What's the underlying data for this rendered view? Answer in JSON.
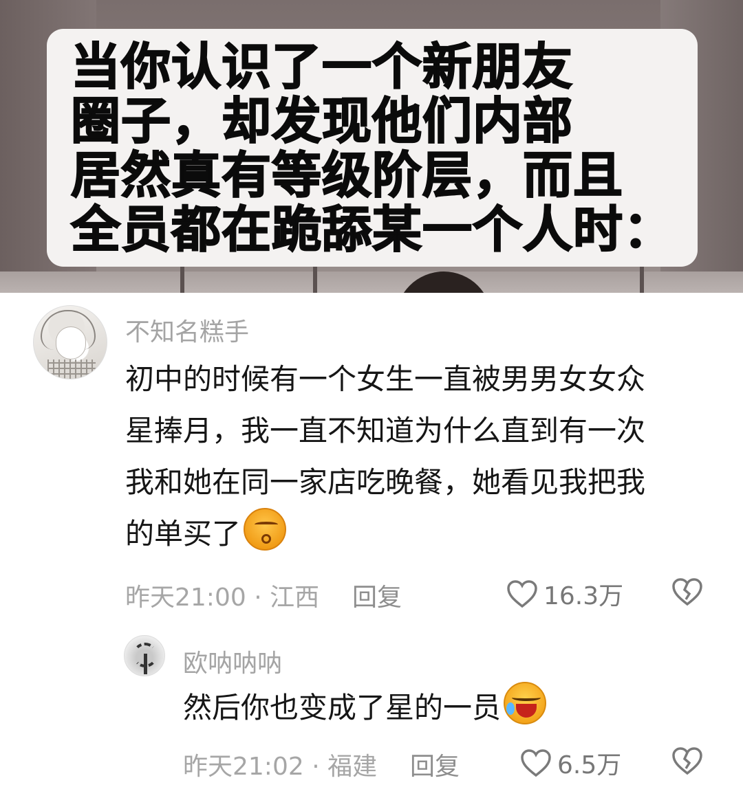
{
  "video": {
    "caption": "当你认识了一个新朋友\n圈子，却发现他们内部\n居然真有等级阶层，而且\n全员都在跪舔某一个人时："
  },
  "comments": [
    {
      "username": "不知名糕手",
      "lines": [
        "初中的时候有一个女生一直被男男女女众",
        "星捧月，我一直不知道为什么直到有一次",
        "我和她在同一家店吃晚餐，她看见我把我",
        "的单买了"
      ],
      "emoji": "smug-face-emoji",
      "time": "昨天21:00",
      "separator": "·",
      "location": "江西",
      "reply_label": "回复",
      "likes": "16.3万",
      "avatar": "anime-girl-avatar"
    },
    {
      "username": "欧呐呐呐",
      "lines": [
        "然后你也变成了星的一员"
      ],
      "emoji": "laughing-crying-emoji",
      "time": "昨天21:02",
      "separator": "·",
      "location": "福建",
      "reply_label": "回复",
      "likes": "6.5万",
      "avatar": "palm-tree-avatar"
    }
  ],
  "icons": {
    "like": "heart-outline-icon",
    "dislike": "broken-heart-icon"
  },
  "colors": {
    "meta_gray": "#a6a6a6",
    "text": "#161616",
    "caption_bg": "#f4f2f1"
  }
}
